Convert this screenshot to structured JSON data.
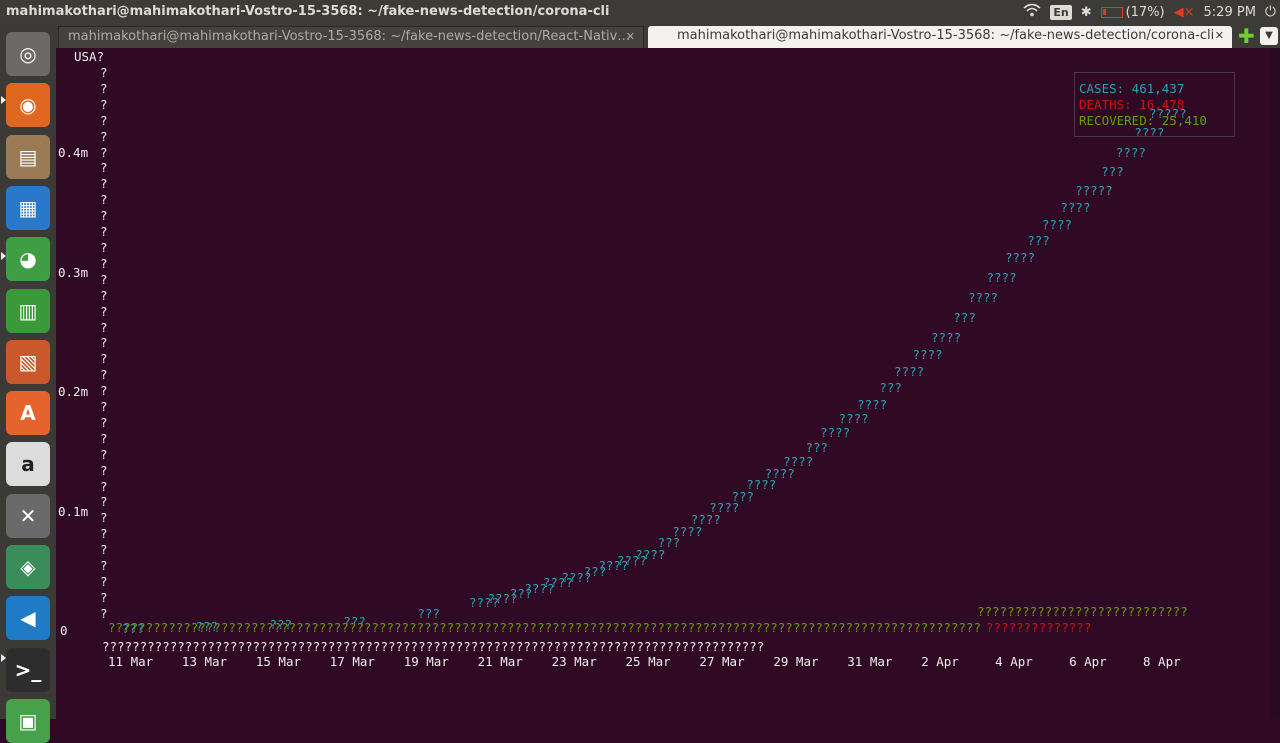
{
  "window": {
    "title": "mahimakothari@mahimakothari-Vostro-15-3568: ~/fake-news-detection/corona-cli"
  },
  "tray": {
    "lang": "En",
    "battery": "(17%)",
    "time": "5:29 PM"
  },
  "launcher": [
    {
      "name": "ubuntu-dash-icon",
      "color": "#6b6a66",
      "glyph": "◎"
    },
    {
      "name": "firefox-icon",
      "color": "#e0671f",
      "glyph": "◉"
    },
    {
      "name": "files-icon",
      "color": "#9a7b56",
      "glyph": "▤"
    },
    {
      "name": "writer-icon",
      "color": "#2a78c9",
      "glyph": "▦"
    },
    {
      "name": "chrome-icon",
      "color": "#3f9e44",
      "glyph": "◕"
    },
    {
      "name": "calc-icon",
      "color": "#3a9a3a",
      "glyph": "▥"
    },
    {
      "name": "impress-icon",
      "color": "#c9582a",
      "glyph": "▧"
    },
    {
      "name": "software-center-icon",
      "color": "#e5632d",
      "glyph": "A"
    },
    {
      "name": "amazon-icon",
      "color": "#dcdcdc",
      "glyph": "a"
    },
    {
      "name": "system-settings-icon",
      "color": "#6a6a6a",
      "glyph": "✕"
    },
    {
      "name": "android-studio-icon",
      "color": "#3a8c5a",
      "glyph": "◈"
    },
    {
      "name": "vscode-icon",
      "color": "#1f7bc6",
      "glyph": "◀"
    },
    {
      "name": "terminal-icon",
      "color": "#2d2d2d",
      "glyph": ">_"
    },
    {
      "name": "drive-icon",
      "color": "#46a14a",
      "glyph": "▣"
    }
  ],
  "tabs": [
    {
      "label": "mahimakothari@mahimakothari-Vostro-15-3568: ~/fake-news-detection/React-Nativ…",
      "active": false
    },
    {
      "label": "mahimakothari@mahimakothari-Vostro-15-3568: ~/fake-news-detection/corona-cli",
      "active": true
    }
  ],
  "chart_data": {
    "type": "line",
    "title": "USA",
    "y_tick_labels": [
      "0.4m",
      "0.3m",
      "0.2m",
      "0.1m",
      "0"
    ],
    "categories": [
      "11 Mar",
      "13 Mar",
      "15 Mar",
      "17 Mar",
      "19 Mar",
      "21 Mar",
      "23 Mar",
      "25 Mar",
      "27 Mar",
      "29 Mar",
      "31 Mar",
      "2 Apr",
      "4 Apr",
      "6 Apr",
      "8 Apr"
    ],
    "series": [
      {
        "name": "CASES",
        "color": "#2aa1b3",
        "values": [
          1000,
          2500,
          3800,
          6700,
          13700,
          25700,
          43700,
          62900,
          101700,
          140600,
          188600,
          244000,
          311600,
          367000,
          432000
        ]
      },
      {
        "name": "DEATHS",
        "color": "#cc1111",
        "values": [
          30,
          50,
          60,
          110,
          200,
          300,
          550,
          950,
          1600,
          2500,
          4000,
          6100,
          8500,
          11000,
          14500
        ]
      },
      {
        "name": "RECOVERED",
        "color": "#5fa000",
        "values": [
          8,
          10,
          12,
          17,
          100,
          170,
          200,
          300,
          500,
          2500,
          7000,
          10000,
          15000,
          19000,
          23000
        ]
      }
    ],
    "legend": [
      "CASES: 461,437",
      "DEATHS: 16,478",
      "RECOVERED: 25,410"
    ],
    "legend_position": "top-right"
  }
}
